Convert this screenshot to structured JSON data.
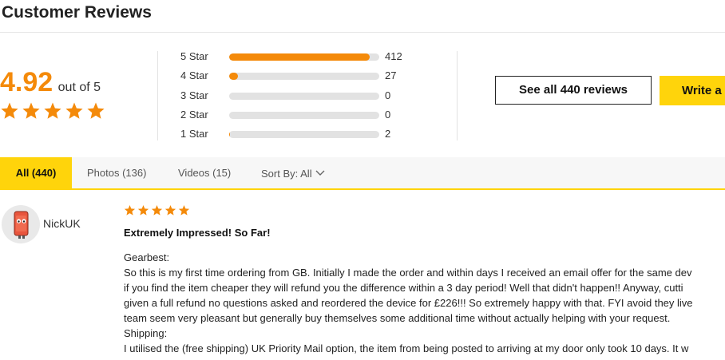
{
  "header": {
    "title": "Customer Reviews"
  },
  "summary": {
    "average": "4.92",
    "out_of": "out of 5",
    "stars_filled": 5,
    "accent_color": "#f48a0a",
    "distribution": [
      {
        "label": "5 Star",
        "count": "412",
        "fraction": 0.936
      },
      {
        "label": "4 Star",
        "count": "27",
        "fraction": 0.061
      },
      {
        "label": "3 Star",
        "count": "0",
        "fraction": 0
      },
      {
        "label": "2 Star",
        "count": "0",
        "fraction": 0
      },
      {
        "label": "1 Star",
        "count": "2",
        "fraction": 0.005
      }
    ]
  },
  "actions": {
    "see_all_label": "See all 440 reviews",
    "write_label": "Write a",
    "write_color": "#ffd40b"
  },
  "tabs": {
    "items": [
      {
        "label": "All (440)",
        "active": true
      },
      {
        "label": "Photos (136)",
        "active": false
      },
      {
        "label": "Videos (15)",
        "active": false
      }
    ],
    "sort_label": "Sort By: All"
  },
  "review": {
    "reviewer": "NickUK",
    "avatar_icon": "phone-character-icon",
    "stars": 5,
    "title": "Extremely Impressed! So Far!",
    "lines": [
      "Gearbest:",
      "So this is my first time ordering from GB. Initially I made the order and within days I received an email offer for the same dev",
      "if you find the item cheaper they will refund you the difference within a 3 day period! Well that didn't happen!! Anyway, cutti",
      "given a full refund no questions asked and reordered the device for £226!!! So extremely happy with that. FYI avoid they live",
      "team seem very pleasant but generally buy themselves some additional time without actually helping with your request.",
      "Shipping:",
      "I utilised the (free shipping) UK Priority Mail option, the item from being posted to arriving at my door only took 10 days. It w"
    ]
  }
}
